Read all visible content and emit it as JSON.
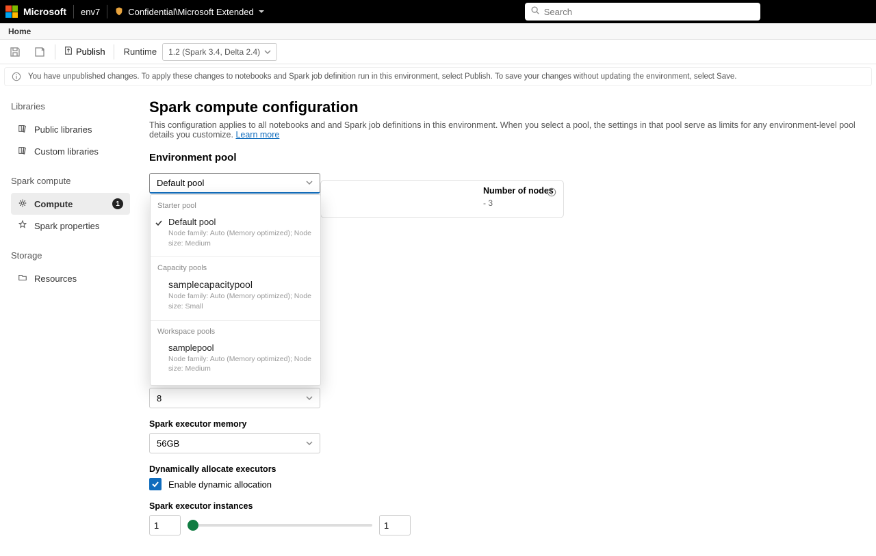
{
  "header": {
    "brand": "Microsoft",
    "env_name": "env7",
    "sensitivity_label": "Confidential\\Microsoft Extended",
    "search_placeholder": "Search"
  },
  "home_strip": {
    "home_label": "Home"
  },
  "command_bar": {
    "publish_label": "Publish",
    "runtime_label": "Runtime",
    "runtime_value": "1.2 (Spark 3.4, Delta 2.4)"
  },
  "info_bar": {
    "message": "You have unpublished changes. To apply these changes to notebooks and Spark job definition run in this environment, select Publish. To save your changes without updating the environment, select Save."
  },
  "sidebar": {
    "groups": [
      {
        "header": "Libraries",
        "items": [
          {
            "label": "Public libraries",
            "icon": "library-icon"
          },
          {
            "label": "Custom libraries",
            "icon": "library-icon"
          }
        ]
      },
      {
        "header": "Spark compute",
        "items": [
          {
            "label": "Compute",
            "icon": "gear-icon",
            "active": true,
            "badge": "1"
          },
          {
            "label": "Spark properties",
            "icon": "spark-icon"
          }
        ]
      },
      {
        "header": "Storage",
        "items": [
          {
            "label": "Resources",
            "icon": "folder-icon"
          }
        ]
      }
    ]
  },
  "content": {
    "page_title": "Spark compute configuration",
    "page_desc": "This configuration applies to all notebooks and and Spark job definitions in this environment. When you select a pool, the settings in that pool serve as limits for any environment-level pool details you customize. ",
    "learn_more": "Learn more",
    "env_pool_section": "Environment pool",
    "selected_pool": "Default pool",
    "dropdown": {
      "starter_label": "Starter pool",
      "starter_option": {
        "name": "Default pool",
        "detail": "Node family: Auto (Memory optimized); Node size: Medium"
      },
      "capacity_label": "Capacity pools",
      "capacity_option": {
        "name": "samplecapacitypool",
        "detail": "Node family: Auto (Memory optimized); Node size: Small"
      },
      "workspace_label": "Workspace pools",
      "workspace_option": {
        "name": "samplepool",
        "detail": "Node family: Auto (Memory optimized); Node size: Medium"
      }
    },
    "card_behind": {
      "label": "Number of nodes",
      "value": "- 3"
    },
    "fields": {
      "executor_cores_value": "8",
      "executor_memory_label": "Spark executor memory",
      "executor_memory_value": "56GB",
      "dynamic_alloc_label": "Dynamically allocate executors",
      "enable_dynamic_label": "Enable dynamic allocation",
      "executor_instances_label": "Spark executor instances",
      "instance_min": "1",
      "instance_max": "1"
    }
  }
}
